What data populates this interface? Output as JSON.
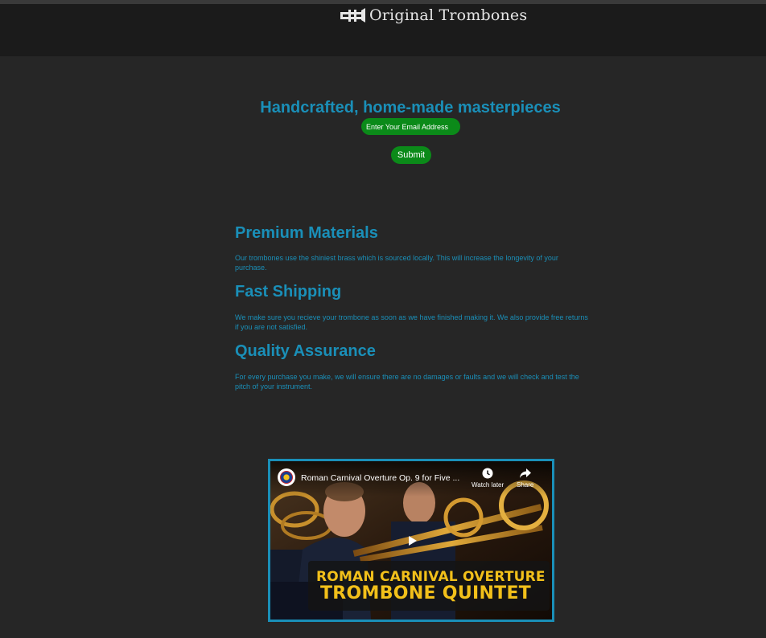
{
  "header": {
    "brand": "Original Trombones",
    "logo_icon": "trombone-logo-icon"
  },
  "hero": {
    "title": "Handcrafted, home-made masterpieces",
    "email_placeholder": "Enter Your Email Address",
    "submit_label": "Submit"
  },
  "features": [
    {
      "title": "Premium Materials",
      "text": "Our trombones use the shiniest brass which is sourced locally. This will increase the longevity of your purchase."
    },
    {
      "title": "Fast Shipping",
      "text": "We make sure you recieve your trombone as soon as we have finished making it. We also provide free returns if you are not satisfied."
    },
    {
      "title": "Quality Assurance",
      "text": "For every purchase you make, we will ensure there are no damages or faults and we will check and test the pitch of your instrument."
    }
  ],
  "video": {
    "title": "Roman Carnival Overture Op. 9 for Five ...",
    "watch_later_label": "Watch later",
    "share_label": "Share",
    "overlay_line1": "ROMAN CARNIVAL OVERTURE",
    "overlay_line2": "TROMBONE QUINTET"
  },
  "colors": {
    "background": "#262626",
    "header": "#1b1b1b",
    "accent": "#1a8fb8",
    "button": "#0b8a19",
    "overlay_text": "#f2c01a"
  }
}
